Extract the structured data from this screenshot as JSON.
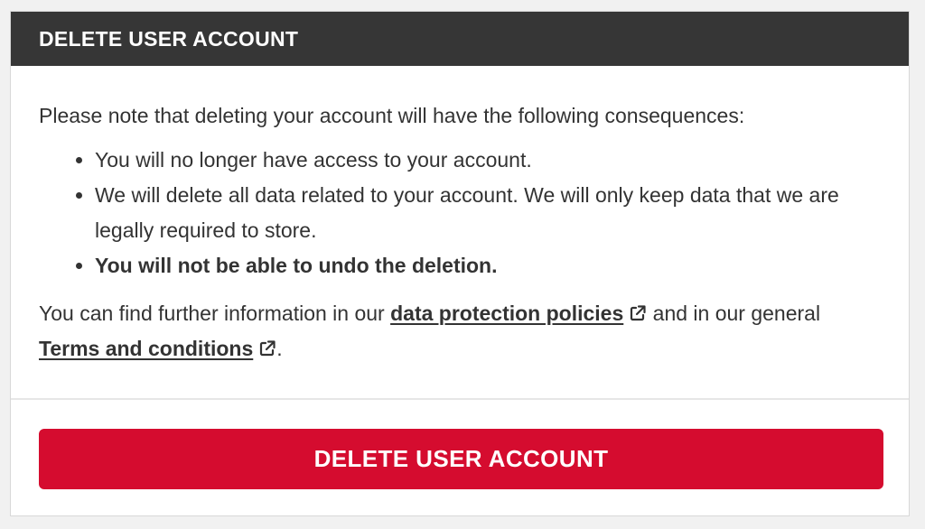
{
  "dialog": {
    "title": "DELETE USER ACCOUNT",
    "intro": "Please note that deleting your account will have the following consequences:",
    "consequences": [
      "You will no longer have access to your account.",
      "We will delete all data related to your account. We will only keep data that we are legally required to store.",
      "You will not be able to undo the deletion."
    ],
    "info": {
      "prefix": "You can find further information in our ",
      "link1_label": "data protection policies",
      "middle": " and in our general ",
      "link2_label": "Terms and conditions",
      "suffix": "."
    },
    "icons": {
      "external_link": "external-link-icon"
    },
    "delete_button_label": "DELETE USER ACCOUNT"
  },
  "colors": {
    "header_bg": "#363636",
    "button_bg": "#d50c2f",
    "text": "#333333"
  }
}
